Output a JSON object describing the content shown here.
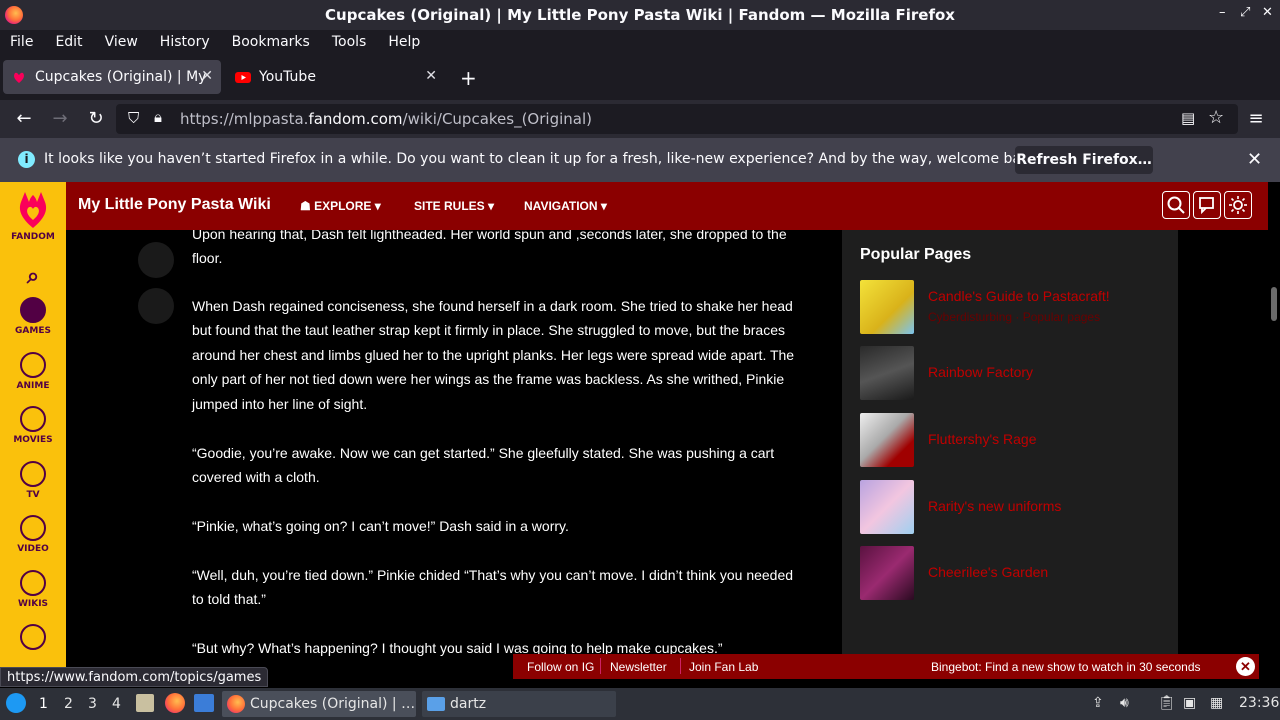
{
  "window": {
    "title": "Cupcakes (Original) | My Little Pony Pasta Wiki | Fandom — Mozilla Firefox",
    "controls": [
      "–",
      "⤢",
      "✕"
    ]
  },
  "menubar": {
    "items": [
      "File",
      "Edit",
      "View",
      "History",
      "Bookmarks",
      "Tools",
      "Help"
    ]
  },
  "tabs": [
    {
      "label": "Cupcakes (Original) | My",
      "active": true,
      "favicon": "fandom-favicon"
    },
    {
      "label": "YouTube",
      "active": false,
      "favicon": "youtube-favicon"
    }
  ],
  "urlbar": {
    "prefix": "https://mlppasta.",
    "domain": "fandom.com",
    "path": "/wiki/Cupcakes_(Original)"
  },
  "notification": {
    "message": "It looks like you haven’t started Firefox in a while. Do you want to clean it up for a fresh, like-new experience? And by the way, welcome back!",
    "button": "Refresh Firefox…"
  },
  "fandom_rail": {
    "brand": "FANDOM",
    "items": [
      "GAMES",
      "ANIME",
      "MOVIES",
      "TV",
      "VIDEO",
      "WIKIS"
    ]
  },
  "wiki": {
    "name": "My Little Pony Pasta Wiki",
    "nav": [
      "EXPLORE",
      "SITE RULES",
      "NAVIGATION"
    ]
  },
  "article": {
    "paragraphs": [
      "Upon hearing that, Dash felt lightheaded. Her world spun and ,seconds later, she dropped to the floor.",
      "When Dash regained conciseness, she found herself in a dark room. She tried to shake her head but found that the taut leather strap kept it firmly in place. She struggled to move, but the braces around her chest and limbs glued her to the upright planks. Her legs were spread wide apart. The only part of her not tied down were her wings as the frame was backless. As she writhed, Pinkie jumped into her line of sight.",
      "“Goodie, you’re awake. Now we can get started.” She gleefully stated. She was pushing a cart covered with a cloth.",
      "“Pinkie, what’s going on? I can’t move!” Dash said in a worry.",
      "“Well, duh, you’re tied down.” Pinkie chided “That’s why you can’t move. I didn’t think you needed to told that.”",
      "“But why? What’s happening? I thought you said I was going to help make cupcakes.”"
    ]
  },
  "popular": {
    "heading": "Popular Pages",
    "items": [
      {
        "title": "Candle's Guide to Pastacraft!",
        "sub": "Cyberdisturbing · Popular pages"
      },
      {
        "title": "Rainbow Factory",
        "sub": ""
      },
      {
        "title": "Fluttershy's Rage",
        "sub": ""
      },
      {
        "title": "Rarity's new uniforms",
        "sub": ""
      },
      {
        "title": "Cheerilee's Garden",
        "sub": ""
      }
    ]
  },
  "fanbar": {
    "links": [
      "Follow on IG",
      "Newsletter",
      "Join Fan Lab"
    ],
    "promo": "Bingebot: Find a new show to watch in 30 seconds"
  },
  "status_url": "https://www.fandom.com/topics/games",
  "taskbar": {
    "workspaces": [
      "1",
      "2",
      "3",
      "4"
    ],
    "tasks": [
      "Cupcakes (Original) | …",
      "dartz"
    ],
    "clock": "23:36"
  },
  "colors": {
    "fandom_yellow": "#fac10c",
    "wiki_red": "#8b0000",
    "firefox_dark": "#2b2a33"
  }
}
